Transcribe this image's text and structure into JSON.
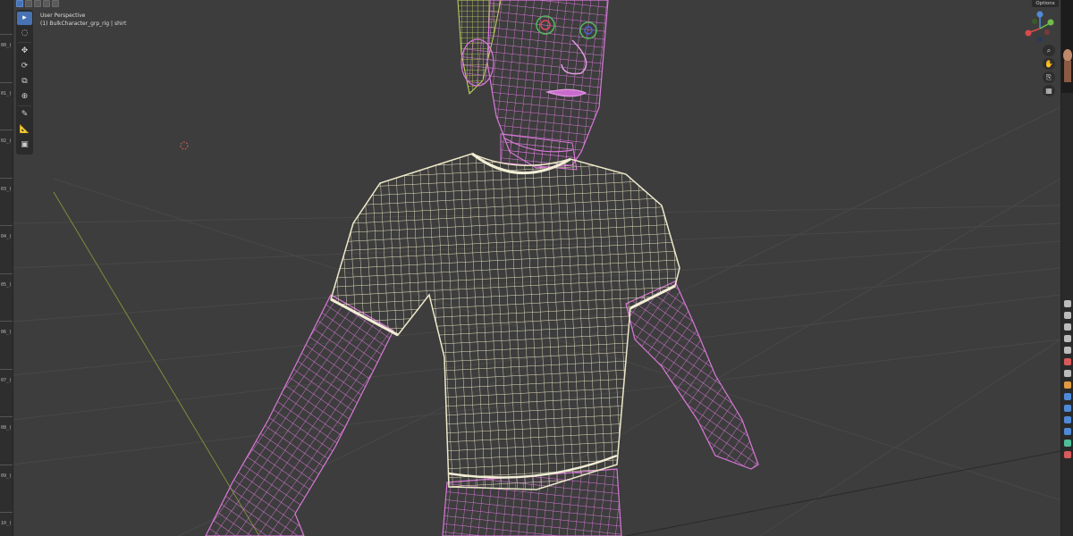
{
  "viewport": {
    "title": "User Perspective",
    "subtitle": "(1) BulkCharacter_grp_rig | shirt"
  },
  "header": {
    "options_label": "Options"
  },
  "timeline": {
    "labels": [
      "00_(",
      "01_(",
      "02_(",
      "03_(",
      "04_(",
      "05_(",
      "06_(",
      "07_(",
      "08_(",
      "09_(",
      "10_("
    ]
  },
  "toolbar": {
    "tools": [
      {
        "name": "select-box-tool",
        "glyph": "▸",
        "active": true
      },
      {
        "name": "cursor-tool",
        "glyph": "◌",
        "active": false
      },
      {
        "name": "move-tool",
        "glyph": "✥",
        "active": false
      },
      {
        "name": "rotate-tool",
        "glyph": "⟳",
        "active": false
      },
      {
        "name": "scale-tool",
        "glyph": "⧉",
        "active": false
      },
      {
        "name": "transform-tool",
        "glyph": "⊕",
        "active": false
      },
      {
        "name": "annotate-tool",
        "glyph": "✎",
        "active": false
      },
      {
        "name": "measure-tool",
        "glyph": "📐",
        "active": false
      },
      {
        "name": "add-cube-tool",
        "glyph": "▣",
        "active": false
      }
    ]
  },
  "navigation": {
    "buttons": [
      {
        "name": "zoom-icon",
        "glyph": "⌕"
      },
      {
        "name": "pan-hand-icon",
        "glyph": "✋"
      },
      {
        "name": "camera-view-icon",
        "glyph": "⎘"
      },
      {
        "name": "perspective-grid-icon",
        "glyph": "▦"
      }
    ]
  },
  "colors": {
    "shirt_wire": "#e8e2bf",
    "body_wire": "#d978d9",
    "hair_wire": "#b8c95a",
    "grid_line": "#4a4a4a",
    "y_axis": "#8a9a3a",
    "accent": "#4772b3"
  }
}
